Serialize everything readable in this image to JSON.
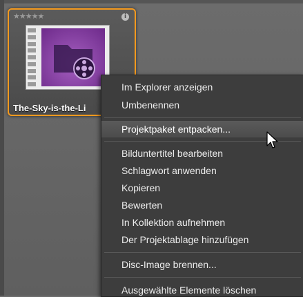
{
  "tile": {
    "rating": "★★★★★",
    "info_glyph": "i",
    "title": "The-Sky-is-the-Li"
  },
  "context_menu": {
    "items": [
      {
        "label": "Im Explorer anzeigen"
      },
      {
        "label": "Umbenennen"
      },
      {
        "label": "Projektpaket entpacken...",
        "highlighted": true
      },
      {
        "label": "Bilduntertitel bearbeiten"
      },
      {
        "label": "Schlagwort anwenden"
      },
      {
        "label": "Kopieren"
      },
      {
        "label": "Bewerten"
      },
      {
        "label": "In Kollektion aufnehmen"
      },
      {
        "label": "Der Projektablage hinzufügen"
      },
      {
        "label": "Disc-Image brennen..."
      },
      {
        "label": "Ausgewählte Elemente löschen"
      }
    ]
  },
  "colors": {
    "selection_border": "#f59a1e",
    "menu_background": "#3d3d3d",
    "thumbnail_purple": "#7b3596"
  },
  "icons": [
    "star-icon",
    "info-icon",
    "film-strip-icon",
    "folder-icon",
    "film-reel-icon",
    "mouse-pointer-icon"
  ]
}
